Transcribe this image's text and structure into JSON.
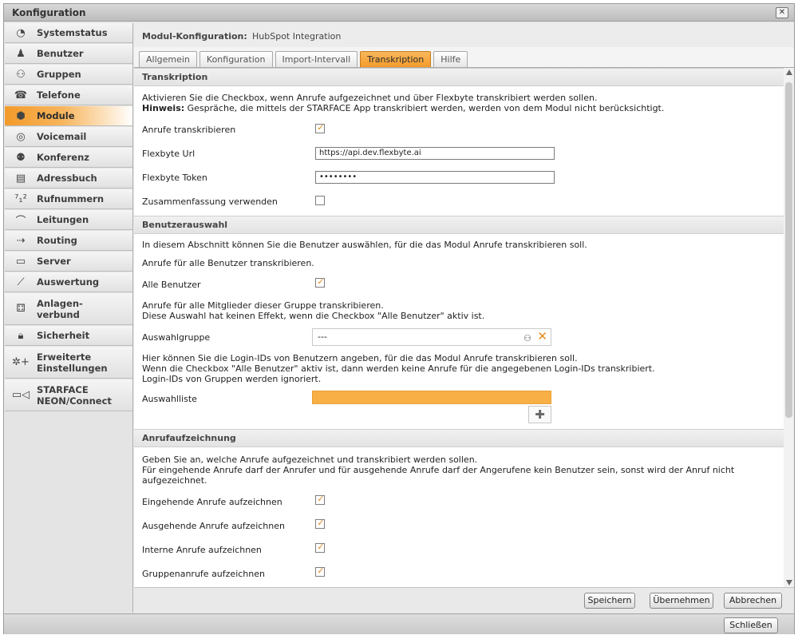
{
  "window": {
    "title": "Konfiguration",
    "close_symbol": "✕",
    "close_label": "Schließen"
  },
  "sidebar": {
    "items": [
      {
        "label": "Systemstatus",
        "icon": "◔",
        "active": false
      },
      {
        "label": "Benutzer",
        "icon": "♟",
        "active": false
      },
      {
        "label": "Gruppen",
        "icon": "⚇",
        "active": false
      },
      {
        "label": "Telefone",
        "icon": "☎",
        "active": false
      },
      {
        "label": "Module",
        "icon": "⬢",
        "active": true
      },
      {
        "label": "Voicemail",
        "icon": "◎",
        "active": false
      },
      {
        "label": "Konferenz",
        "icon": "⚉",
        "active": false
      },
      {
        "label": "Adressbuch",
        "icon": "▤",
        "active": false
      },
      {
        "label": "Rufnummern",
        "icon": "⁷₁²",
        "active": false
      },
      {
        "label": "Leitungen",
        "icon": "⌒",
        "active": false
      },
      {
        "label": "Routing",
        "icon": "⇢",
        "active": false
      },
      {
        "label": "Server",
        "icon": "▭",
        "active": false
      },
      {
        "label": "Auswertung",
        "icon": "⟋",
        "active": false
      },
      {
        "label": "Anlagen-\nverbund",
        "icon": "⚃",
        "active": false
      },
      {
        "label": "Sicherheit",
        "icon": "🔒︎",
        "active": false
      },
      {
        "label": "Erweiterte\nEinstellungen",
        "icon": "✲+",
        "active": false
      },
      {
        "label": "STARFACE\nNEON/Connect",
        "icon": "▭◁",
        "active": false
      }
    ]
  },
  "module_header": {
    "label": "Modul-Konfiguration:",
    "name": "HubSpot Integration"
  },
  "tabs": [
    {
      "label": "Allgemein",
      "active": false
    },
    {
      "label": "Konfiguration",
      "active": false
    },
    {
      "label": "Import-Intervall",
      "active": false
    },
    {
      "label": "Transkription",
      "active": true
    },
    {
      "label": "Hilfe",
      "active": false
    }
  ],
  "transkription": {
    "heading": "Transkription",
    "intro": "Aktivieren Sie die Checkbox, wenn Anrufe aufgezeichnet und über Flexbyte transkribiert werden sollen.",
    "hint_label": "Hinweis:",
    "hint_text": " Gespräche, die mittels der STARFACE App transkribiert werden, werden von dem Modul nicht berücksichtigt.",
    "transcribe_label": "Anrufe transkribieren",
    "transcribe_checked": true,
    "url_label": "Flexbyte Url",
    "url_value": "https://api.dev.flexbyte.ai",
    "token_label": "Flexbyte Token",
    "token_value": "••••••••",
    "summary_label": "Zusammenfassung verwenden",
    "summary_checked": false
  },
  "benutzerauswahl": {
    "heading": "Benutzerauswahl",
    "intro": "In diesem Abschnitt können Sie die Benutzer auswählen, für die das Modul Anrufe transkribieren soll.",
    "all_users_text": "Anrufe für alle Benutzer transkribieren.",
    "all_users_label": "Alle Benutzer",
    "all_users_checked": true,
    "group_text_1": "Anrufe für alle Mitglieder dieser Gruppe transkribieren.",
    "group_text_2": "Diese Auswahl hat keinen Effekt, wenn die Checkbox \"Alle Benutzer\" aktiv ist.",
    "group_label": "Auswahlgruppe",
    "group_value": "---",
    "login_text_1": "Hier können Sie die Login-IDs von Benutzern angeben, für die das Modul Anrufe transkribieren soll.",
    "login_text_2": "Wenn die Checkbox \"Alle Benutzer\" aktiv ist, dann werden keine Anrufe für die angegebenen Login-IDs transkribiert.",
    "login_text_3": "Login-IDs von Gruppen werden ignoriert.",
    "list_label": "Auswahlliste",
    "plus_symbol": "✚"
  },
  "anrufaufzeichnung": {
    "heading": "Anrufaufzeichnung",
    "text_1": "Geben Sie an, welche Anrufe aufgezeichnet und transkribiert werden sollen.",
    "text_2": "Für eingehende Anrufe darf der Anrufer und für ausgehende Anrufe darf der Angerufene kein Benutzer sein, sonst wird der Anruf nicht",
    "text_3": "aufgezeichnet.",
    "options": [
      {
        "label": "Eingehende Anrufe aufzeichnen",
        "checked": true
      },
      {
        "label": "Ausgehende Anrufe aufzeichnen",
        "checked": true
      },
      {
        "label": "Interne Anrufe aufzeichnen",
        "checked": true
      },
      {
        "label": "Gruppenanrufe aufzeichnen",
        "checked": true
      }
    ]
  },
  "actions": {
    "save": "Speichern",
    "apply": "Übernehmen",
    "cancel": "Abbrechen"
  },
  "colors": {
    "accent": "#f39a2a",
    "check": "#e38a1d"
  },
  "check_symbol": "✓"
}
